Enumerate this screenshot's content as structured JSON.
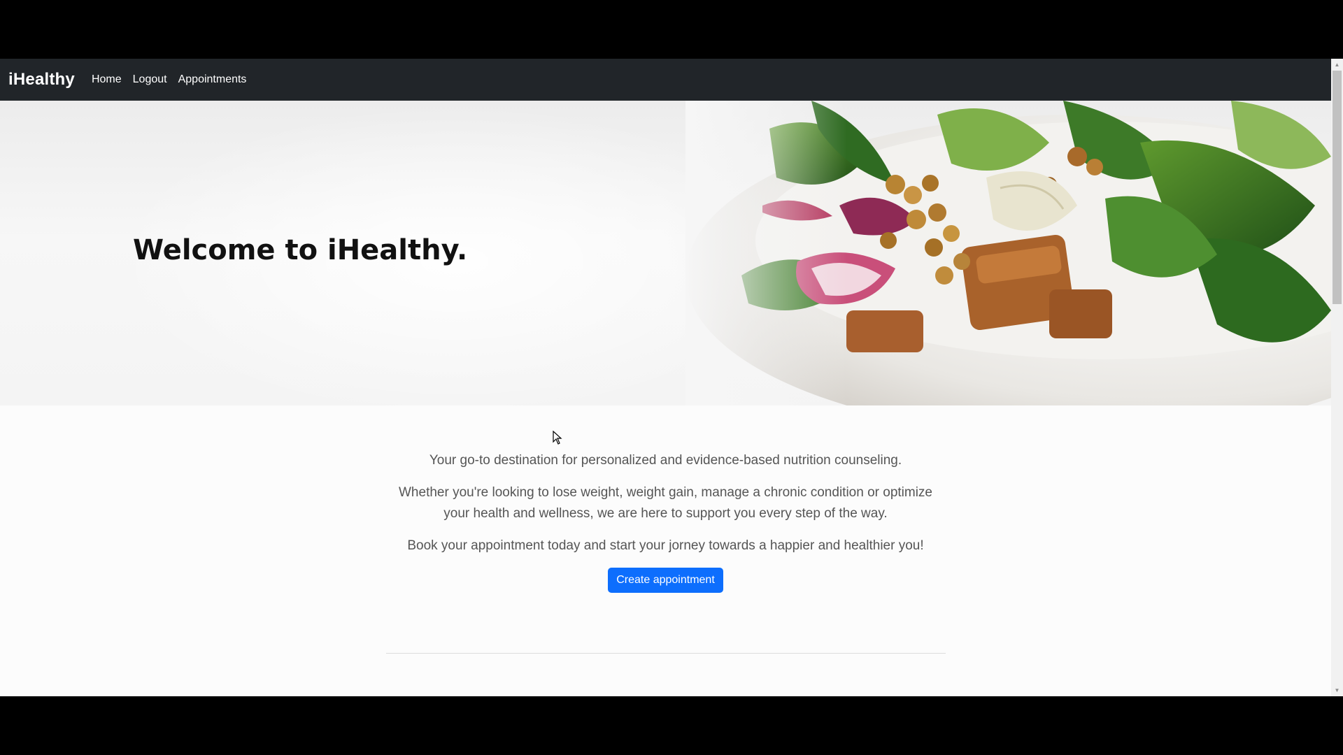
{
  "navbar": {
    "brand": "iHealthy",
    "links": [
      "Home",
      "Logout",
      "Appointments"
    ]
  },
  "hero": {
    "title": "Welcome to iHealthy."
  },
  "main": {
    "intro": "Your go-to destination for personalized and evidence-based nutrition counseling.",
    "support": "Whether you're looking to lose weight, weight gain, manage a chronic condition or optimize your health and wellness, we are here to support you every step of the way.",
    "cta_text": "Book your appointment today and start your jorney towards a happier and healthier you!",
    "button_label": "Create appointment"
  },
  "colors": {
    "navbar": "#212529",
    "primary_button": "#0d6efd"
  },
  "icons": {
    "scroll_up": "triangle-up-icon",
    "scroll_down": "triangle-down-icon",
    "cursor": "mouse-pointer-icon"
  }
}
